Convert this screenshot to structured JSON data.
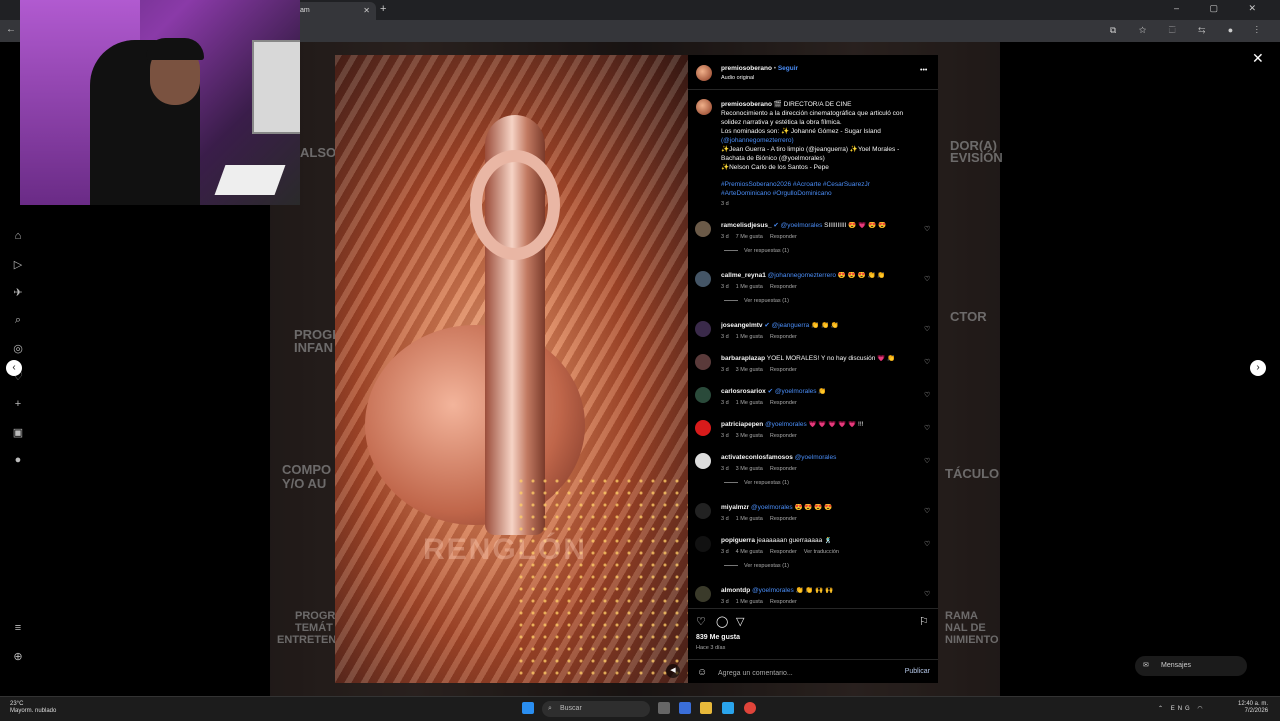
{
  "browser": {
    "tab_title": "am",
    "new_tab": "+",
    "close_tab": "✕",
    "window_controls": "–  ▢  ✕",
    "back": "←",
    "omnibox_icons": "⧉ ☆ ⬚ ⇆ ● ⋮"
  },
  "background_words": [
    "ALSO",
    "DOR(A)",
    "EVISIÓN",
    "PROGR",
    "INFAN",
    "CTOR",
    "COMPO",
    "Y/O AU",
    "TÁCULO",
    "PROGR",
    "TEMÁT",
    "ENTRETEN",
    "RAMA",
    "NAL DE",
    "NIMIENTO"
  ],
  "instagram_nav": [
    "⌂",
    "▷",
    "✈",
    "⌕",
    "◎",
    "♡",
    "+",
    "▣",
    "●",
    "≡",
    "⊕"
  ],
  "modal": {
    "close": "✕",
    "prev": "‹",
    "next": "›",
    "media_watermark": "RENGLÓN",
    "mute": "◀"
  },
  "post": {
    "author": "premiosoberano",
    "follow": "Seguir",
    "audio": "Audio original",
    "more": "•••",
    "caption_lines": [
      "🎬 DIRECTOR/A DE CINE",
      "Reconocimiento a la dirección cinematográfica que articuló con",
      "solidez narrativa y estética la obra fílmica.",
      "Los nominados son: ✨ Johanné Gómez - Sugar Island",
      "(@johannegomezterrero)",
      "✨Jean Guerra - A tiro limpio (@jeanguerra) ✨Yoel Morales -",
      "Bachata de Biónico (@yoelmorales)",
      "✨Nelson Carlo de los Santos - Pepe"
    ],
    "hashtags": [
      "#PremiosSoberano2026 #Acroarte #CesarSuarezJr",
      "#ArteDominicano #OrgulloDominicano"
    ],
    "caption_time": "3 d",
    "likes": "839 Me gusta",
    "posted_ago": "Hace 3 días",
    "comment_placeholder": "Agrega un comentario...",
    "publish": "Publicar"
  },
  "comments": [
    {
      "user": "ramcelisdjesus_",
      "verified": true,
      "mention": "@yoelmorales",
      "text": "SIIIIIIIIII 😍 💗 😍 😍",
      "time": "3 d",
      "likes": "7 Me gusta",
      "reply": "Responder",
      "replies": "Ver respuestas (1)",
      "avatar": "#6b5a48"
    },
    {
      "user": "callme_reyna1",
      "verified": false,
      "mention": "@johannegomezterrero",
      "text": "😍 😍 😍 👏 👏",
      "time": "3 d",
      "likes": "1 Me gusta",
      "reply": "Responder",
      "replies": "Ver respuestas (1)",
      "avatar": "#445566"
    },
    {
      "user": "joseangelmtv",
      "verified": true,
      "mention": "@jeanguerra",
      "text": "👏 👏 👏",
      "time": "3 d",
      "likes": "1 Me gusta",
      "reply": "Responder",
      "replies": "",
      "avatar": "#3a2a4a"
    },
    {
      "user": "barbaraplazap",
      "verified": false,
      "mention": "",
      "text": "YOEL MORALES! Y no hay discusión 💗 👏",
      "time": "3 d",
      "likes": "3 Me gusta",
      "reply": "Responder",
      "replies": "",
      "avatar": "#5a3a3a"
    },
    {
      "user": "carlosrosariox",
      "verified": true,
      "mention": "@yoelmorales",
      "text": "👏",
      "time": "3 d",
      "likes": "1 Me gusta",
      "reply": "Responder",
      "replies": "",
      "avatar": "#2a4a3a"
    },
    {
      "user": "patriciapepen",
      "verified": false,
      "mention": "@yoelmorales",
      "text": "💗 💗 💗 💗 💗 !!!",
      "time": "3 d",
      "likes": "3 Me gusta",
      "reply": "Responder",
      "replies": "",
      "avatar": "#d81b1b"
    },
    {
      "user": "activateconlosfamosos",
      "verified": false,
      "mention": "@yoelmorales",
      "text": "",
      "time": "3 d",
      "likes": "3 Me gusta",
      "reply": "Responder",
      "replies": "Ver respuestas (1)",
      "avatar": "#dddddd"
    },
    {
      "user": "miyalmzr",
      "verified": false,
      "mention": "@yoelmorales",
      "text": "😍 😍 😍 😍",
      "time": "3 d",
      "likes": "1 Me gusta",
      "reply": "Responder",
      "replies": "",
      "avatar": "#222222"
    },
    {
      "user": "popiguerra",
      "verified": false,
      "mention": "",
      "text": "jeaaaaaan guerraaaaa 🕺",
      "time": "3 d",
      "likes": "4 Me gusta",
      "reply": "Responder",
      "translate": "Ver traducción",
      "replies": "Ver respuestas (1)",
      "avatar": "#111111"
    },
    {
      "user": "almontdp",
      "verified": false,
      "mention": "@yoelmorales",
      "text": "👏 👏 🙌 🙌",
      "time": "3 d",
      "likes": "1 Me gusta",
      "reply": "Responder",
      "replies": "",
      "avatar": "#3a3a2a"
    }
  ],
  "messages_pill": "Mensajes",
  "taskbar": {
    "temp": "23°C",
    "weather": "Mayorm. nublado",
    "search": "Buscar",
    "lang": "ENG",
    "time": "12:40 a. m.",
    "date": "7/2/2026"
  }
}
